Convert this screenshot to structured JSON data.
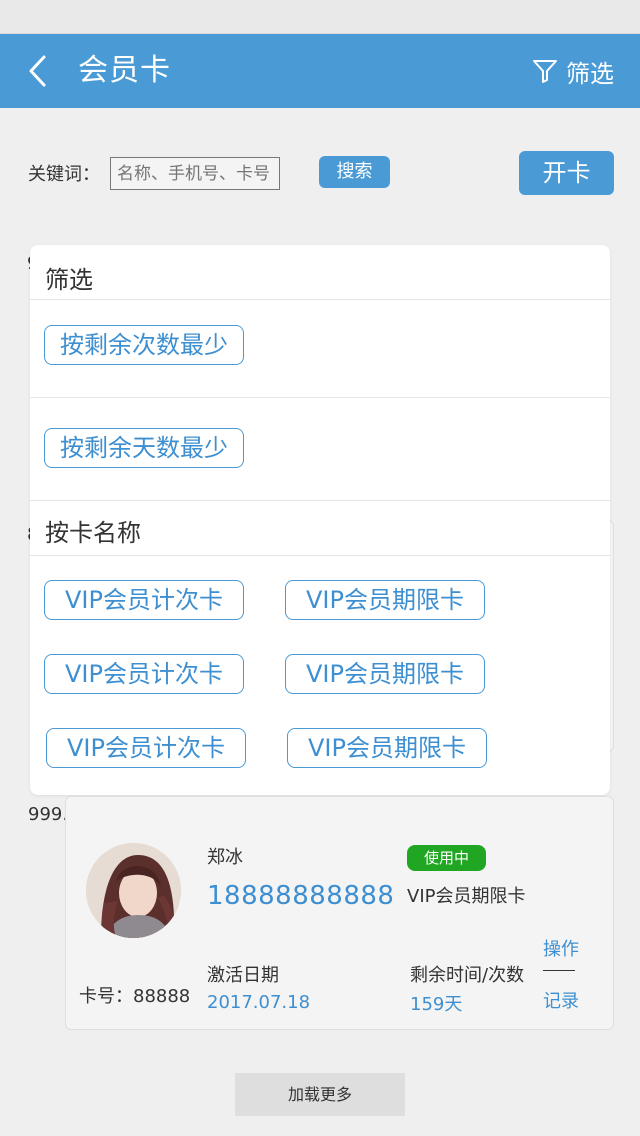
{
  "header": {
    "title": "会员卡",
    "filter_label": "筛选"
  },
  "search": {
    "keyword_label": "关键词：",
    "placeholder": "名称、手机号、卡号",
    "search_label": "搜索",
    "open_card_label": "开卡"
  },
  "background": {
    "edge_text_a": "9",
    "edge_text_b": "8",
    "left_value": "999."
  },
  "filter_panel": {
    "title": "筛选",
    "sort_options": [
      "按剩余次数最少",
      "按剩余天数最少"
    ],
    "card_name_section_title": "按卡名称",
    "card_names": [
      [
        "VIP会员计次卡",
        "VIP会员期限卡"
      ],
      [
        "VIP会员计次卡",
        "VIP会员期限卡"
      ],
      [
        "VIP会员计次卡",
        "VIP会员期限卡"
      ]
    ]
  },
  "member": {
    "name": "郑冰",
    "phone": "18888888888",
    "status": "使用中",
    "card_type": "VIP会员期限卡",
    "card_no": "卡号：88888",
    "activation_label": "激活日期",
    "activation_date": "2017.07.18",
    "remaining_label": "剩余时间/次数",
    "remaining_value": "159天",
    "operate_label": "操作",
    "record_label": "记录"
  },
  "footer": {
    "load_more": "加载更多"
  },
  "colors": {
    "primary": "#4a9ad6",
    "status_green": "#21a623",
    "link_blue": "#3d8fd1"
  }
}
